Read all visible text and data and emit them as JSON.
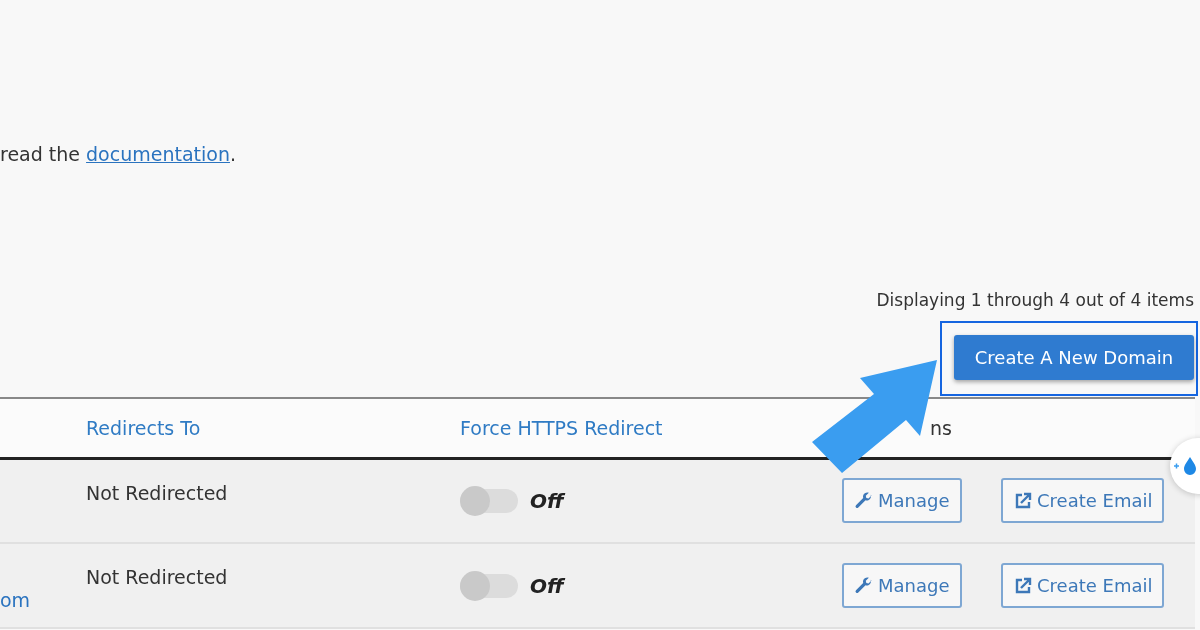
{
  "intro": {
    "text": "read the ",
    "link": "documentation",
    "after": "."
  },
  "pagination": {
    "summary": "Displaying 1 through 4 out of 4 items"
  },
  "create_button": {
    "label": "Create A New Domain",
    "highlighted": true
  },
  "table": {
    "columns": [
      {
        "label": "Redirects To"
      },
      {
        "label": "Force HTTPS Redirect"
      },
      {
        "label": "ns"
      }
    ],
    "rows": [
      {
        "redirects_to": "Not Redirected",
        "force_https": {
          "on": false,
          "label": "Off"
        },
        "actions": [
          "Manage",
          "Create Email"
        ]
      },
      {
        "domain": "om",
        "redirects_to": "Not Redirected",
        "force_https": {
          "on": false,
          "label": "Off"
        },
        "actions": [
          "Manage",
          "Create Email"
        ]
      }
    ]
  }
}
